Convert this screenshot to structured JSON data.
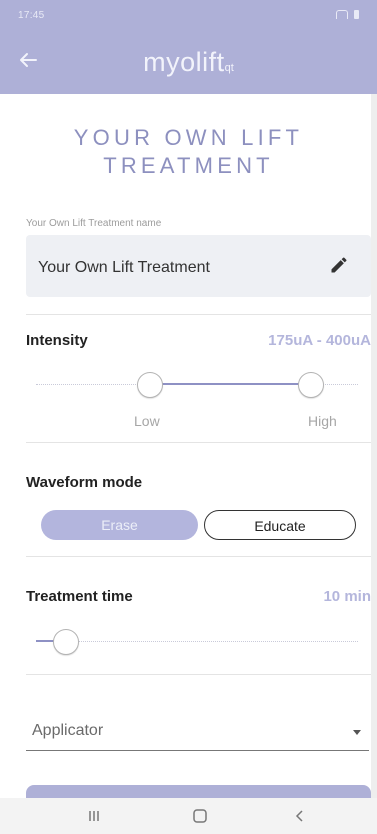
{
  "status_bar": {
    "time": "17:45"
  },
  "app_bar": {
    "brand": "myolift",
    "brand_suffix": "qt"
  },
  "page": {
    "title_line1": "YOUR OWN LIFT",
    "title_line2": "TREATMENT"
  },
  "treatment_name": {
    "label": "Your Own Lift Treatment name",
    "value": "Your Own Lift Treatment"
  },
  "intensity": {
    "label": "Intensity",
    "range_text": "175uA - 400uA",
    "low_label": "Low",
    "high_label": "High",
    "low_fraction": 0.35,
    "high_fraction": 0.85
  },
  "waveform": {
    "label": "Waveform mode",
    "options": [
      "Erase",
      "Educate"
    ],
    "selected": "Erase"
  },
  "treatment_time": {
    "label": "Treatment time",
    "value": "10 min",
    "fraction": 0.09
  },
  "applicator": {
    "placeholder": "Applicator"
  },
  "colors": {
    "header": "#aeb0d7",
    "accent": "#8e91c4",
    "title": "#8d90bf",
    "value_text": "#b4b6dc"
  }
}
